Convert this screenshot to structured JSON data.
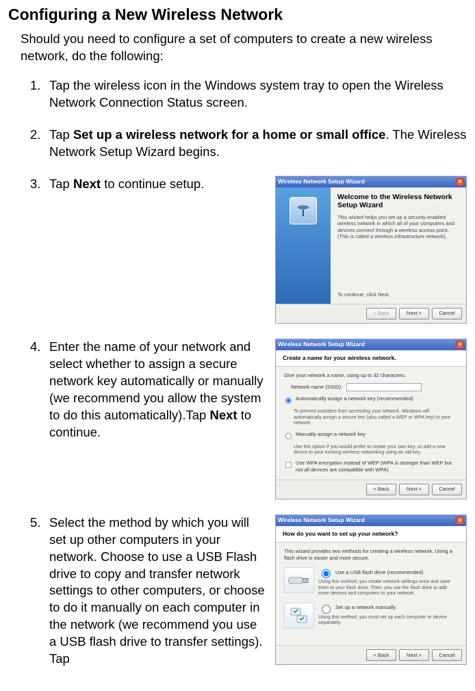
{
  "title": "Configuring a New Wireless Network",
  "intro": "Should you need to configure a set of computers to create a new wireless network, do the following:",
  "steps": [
    {
      "num": "1.",
      "parts": [
        "Tap the wireless icon in the Windows system tray to open the Wireless Network Connection Status screen."
      ]
    },
    {
      "num": "2.",
      "parts": [
        "Tap ",
        "Set up a wireless network for a home or small office",
        ". The Wireless Network Setup Wizard begins."
      ]
    },
    {
      "num": "3.",
      "parts": [
        "Tap ",
        "Next",
        " to continue setup."
      ]
    },
    {
      "num": "4.",
      "parts": [
        "Enter the name of your network and select whether to assign a secure network key automatically or manually (we recommend you allow the system to do this automatically).Tap ",
        "Next",
        " to continue."
      ]
    },
    {
      "num": "5.",
      "parts": [
        "Select the method by which you will set up other computers in your network. Choose to use a USB Flash drive to copy and transfer network settings to other computers, or choose to do it manually on each computer in the network (we recommend you use a USB flash drive to transfer settings). Tap"
      ]
    }
  ],
  "wizard": {
    "title": "Wireless Network Setup Wizard",
    "welcome_heading": "Welcome to the Wireless Network Setup Wizard",
    "welcome_desc": "This wizard helps you set up a security-enabled wireless network in which all of your computers and devices connect through a wireless access point. (This is called a wireless infrastructure network).",
    "welcome_cont": "To continue, click Next.",
    "btn_back": "< Back",
    "btn_next": "Next >",
    "btn_cancel": "Cancel",
    "create_title": "Create a name for your wireless network.",
    "create_hint": "Give your network a name, using up to 32 characters.",
    "ssid_label": "Network name (SSID):",
    "auto_label": "Automatically assign a network key (recommended)",
    "auto_sub": "To prevent outsiders from accessing your network, Windows will automatically assign a secure key (also called a WEP or WPA key) to your network.",
    "manual_label": "Manually assign a network key",
    "manual_sub": "Use this option if you would prefer to create your own key, or add a new device to your existing wireless networking using an old key.",
    "wpa_label": "Use WPA encryption instead of WEP (WPA is stronger than WEP but not all devices are compatible with WPA)",
    "method_title": "How do you want to set up your network?",
    "method_intro": "This wizard provides two methods for creating a wireless network. Using a flash drive is easier and more secure.",
    "usb_label": "Use a USB flash drive (recommended)",
    "usb_sub": "Using this method, you create network settings once and save them to your flash drive. Then, you use the flash drive to add more devices and computers to your network.",
    "man_label": "Set up a network manually",
    "man_sub": "Using this method, you must set up each computer or device separately."
  }
}
